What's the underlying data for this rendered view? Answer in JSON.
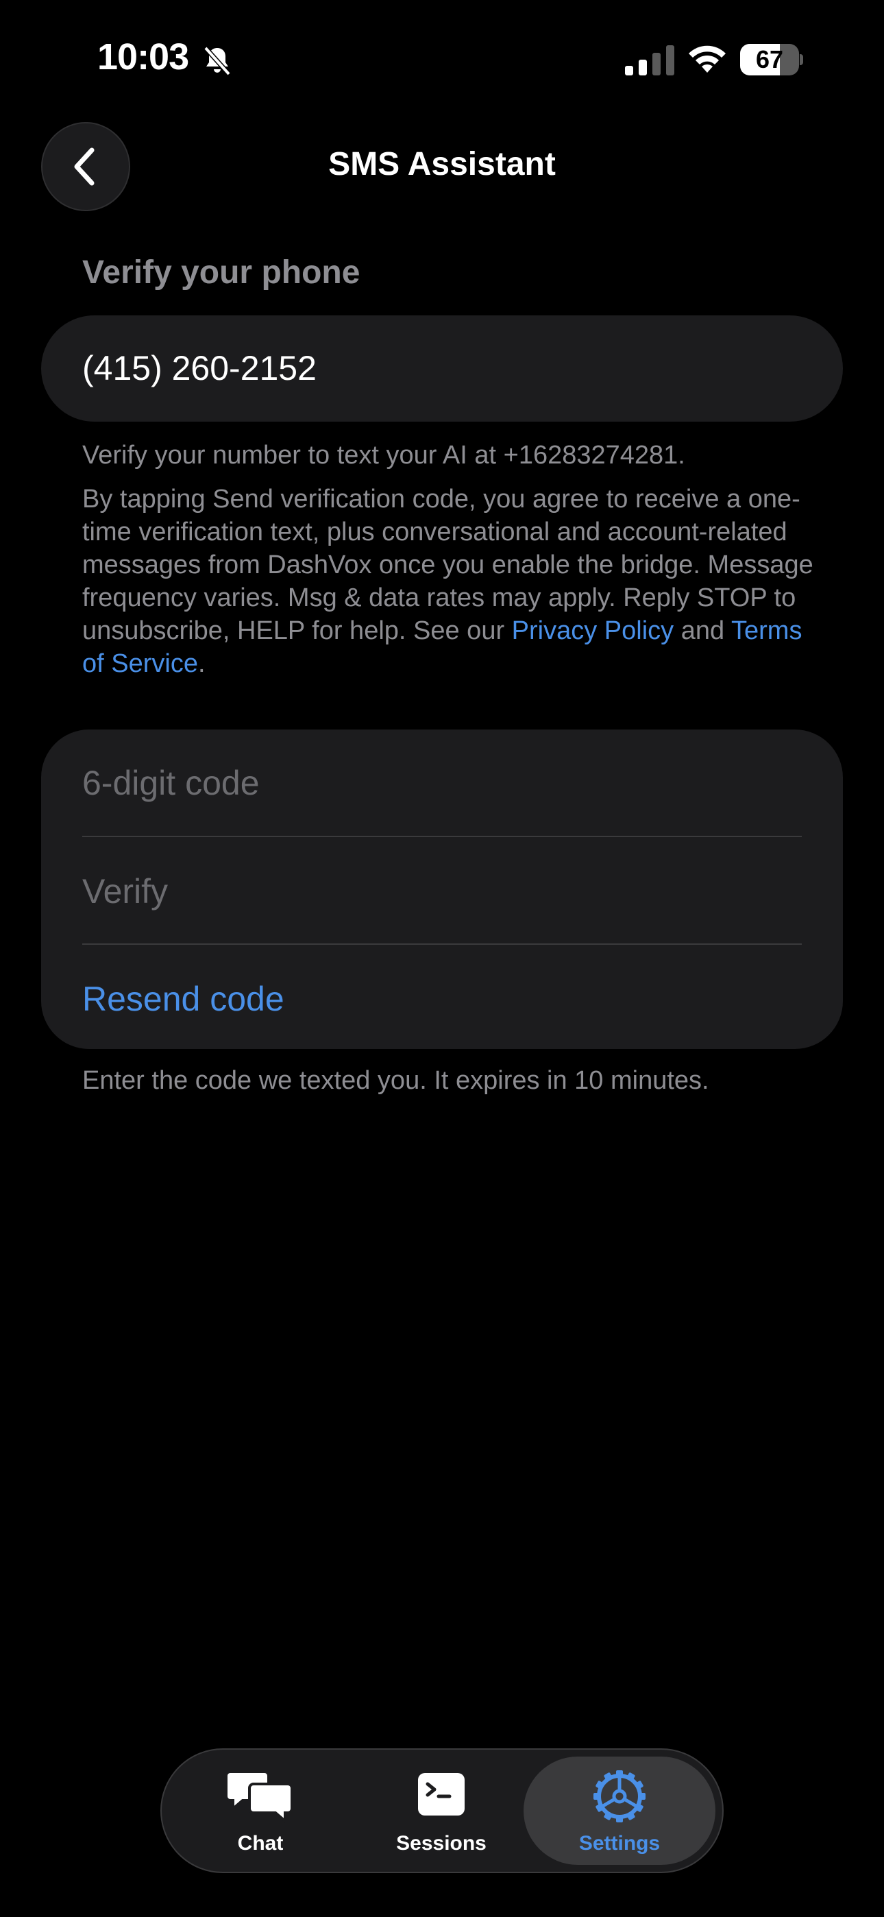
{
  "status_bar": {
    "time": "10:03",
    "battery_percent": 67
  },
  "header": {
    "title": "SMS Assistant"
  },
  "phone_section": {
    "heading": "Verify your phone",
    "phone_value": "(415) 260-2152",
    "helper_text": "Verify your number to text your AI at +16283274281.",
    "legal": {
      "text_before": "By tapping Send verification code, you agree to receive a one-time verification text, plus conversational and account-related messages from DashVox once you enable the bridge. Message frequency varies. Msg & data rates may apply. Reply STOP to unsubscribe, HELP for help. See our ",
      "privacy_link": "Privacy Policy",
      "connector": " and ",
      "terms_link": "Terms of Service",
      "end": "."
    }
  },
  "code_card": {
    "code_placeholder": "6-digit code",
    "verify_label": "Verify",
    "resend_label": "Resend code",
    "footnote": "Enter the code we texted you. It expires in 10 minutes."
  },
  "tab_bar": {
    "tabs": [
      {
        "label": "Chat",
        "icon": "chat-bubbles-icon"
      },
      {
        "label": "Sessions",
        "icon": "terminal-icon"
      },
      {
        "label": "Settings",
        "icon": "gear-icon",
        "selected": true
      }
    ]
  },
  "colors": {
    "accent": "#4a90e8",
    "background": "#000000",
    "card": "#1c1c1e",
    "secondary_text": "#8e8e93"
  }
}
